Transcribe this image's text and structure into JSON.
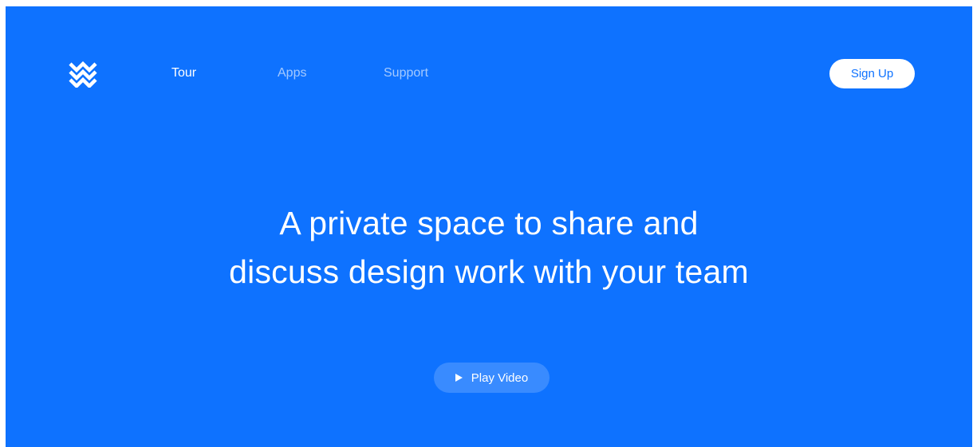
{
  "brand": {
    "logo_icon": "zigzag-waves-icon",
    "color": "#0e72ff"
  },
  "nav": {
    "items": [
      {
        "label": "Tour",
        "active": true
      },
      {
        "label": "Apps",
        "active": false
      },
      {
        "label": "Support",
        "active": false
      }
    ]
  },
  "header": {
    "signup_label": "Sign Up"
  },
  "hero": {
    "headline_line1": "A private space to share and",
    "headline_line2": "discuss design work with your team",
    "play_label": "Play Video",
    "play_icon": "play-icon"
  }
}
